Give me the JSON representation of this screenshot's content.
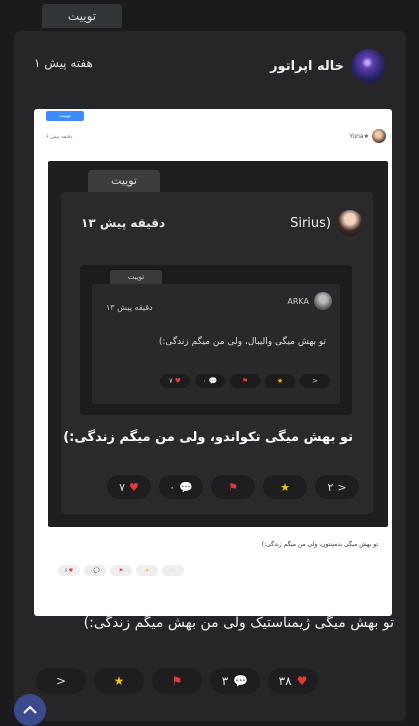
{
  "top_tab": "توییت",
  "post": {
    "author": "خاله اپراتور",
    "time": "۱ هفته پیش",
    "text": "تو بهش میگی ژیمناستیک ولی من بهش میگم زندگی:)",
    "actions": {
      "likes": "۳۸",
      "comments": "۳"
    }
  },
  "screenshot": {
    "tab": "توییت",
    "author": "★Yuna",
    "time": "۶ دقیقه پیش",
    "caption": "تو بهش میگی بدمینتون، ولی من میگم زندگی:)",
    "actions": {
      "likes": "۶",
      "comments": "۰"
    },
    "inner": {
      "tab": "توییت",
      "author": "(Sirius",
      "time": "۱۳ دقیقه پیش",
      "text": "تو بهش میگی تکواندو، ولی من میگم زندگی:)",
      "actions": {
        "shares": "۲",
        "comments": "۰",
        "likes": "۷"
      },
      "nested": {
        "tab": "توییت",
        "author": "ARKA",
        "time": "۱۳ دقیقه پیش",
        "text": "تو بهش میگی والیبال، ولی من میگم زندگی:)",
        "actions": {
          "comments": "۰",
          "likes": "۷"
        }
      }
    }
  },
  "icons": {
    "like": "heart-icon",
    "comment": "comment-icon",
    "report": "flag-icon",
    "favorite": "star-icon",
    "share": "share-icon",
    "scroll": "chevron-up-icon"
  },
  "colors": {
    "heart": "#e53935",
    "star": "#f4c20d",
    "scroll_button": "#3b4a8c"
  }
}
